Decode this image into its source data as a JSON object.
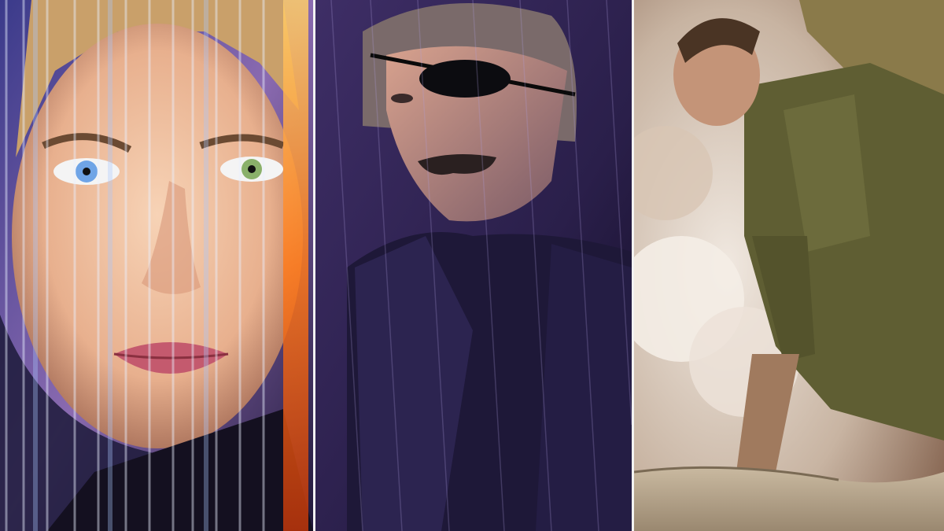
{
  "collage": {
    "panels": [
      {
        "subject": "woman-portrait-light-streaks",
        "palette": [
          "#f2c7a6",
          "#6fa4e6",
          "#ff8a2a",
          "#1a1530"
        ]
      },
      {
        "subject": "man-eyepatch-dark-coat",
        "palette": [
          "#3a2a5a",
          "#6a4a8a",
          "#1a1230",
          "#c98f7a"
        ]
      },
      {
        "subject": "soldier-sandbags-smoke",
        "palette": [
          "#6b6a3a",
          "#b9a890",
          "#e6ddd2",
          "#8a6a52"
        ]
      }
    ],
    "divider_color": "#f2f2f2"
  }
}
